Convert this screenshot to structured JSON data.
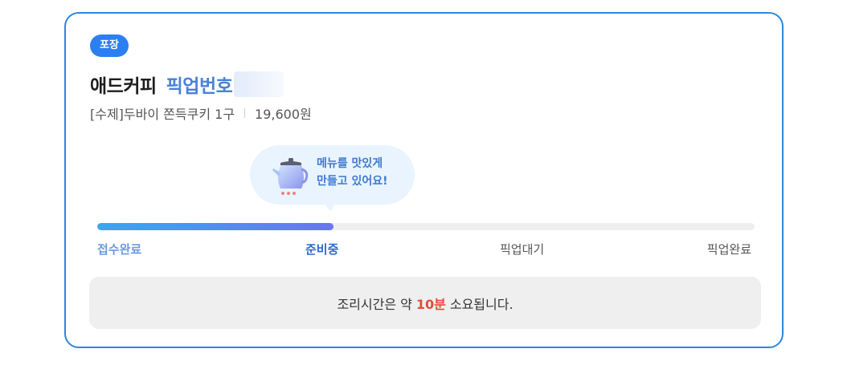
{
  "order": {
    "badge": "포장",
    "store_name": "애드커피",
    "pickup_label": "픽업번호",
    "item_text": "[수제]두바이 쫀득쿠키 1구",
    "price": "19,600원"
  },
  "status": {
    "bubble_text": "메뉴를 맛있게\n만들고 있어요!",
    "progress_fraction": 0.36,
    "steps": [
      "접수완료",
      "준비중",
      "픽업대기",
      "픽업완료"
    ],
    "active_step_index": 1
  },
  "notice": {
    "prefix": "조리시간은 약",
    "time": "10분",
    "suffix": "소요됩니다."
  },
  "colors": {
    "accent": "#2b7ff0",
    "card_border": "#2f86dd",
    "highlight": "#e64a3c",
    "progress_start": "#3aa6f2",
    "progress_end": "#6a76ef"
  },
  "icons": {
    "bubble": "kettle-icon"
  }
}
